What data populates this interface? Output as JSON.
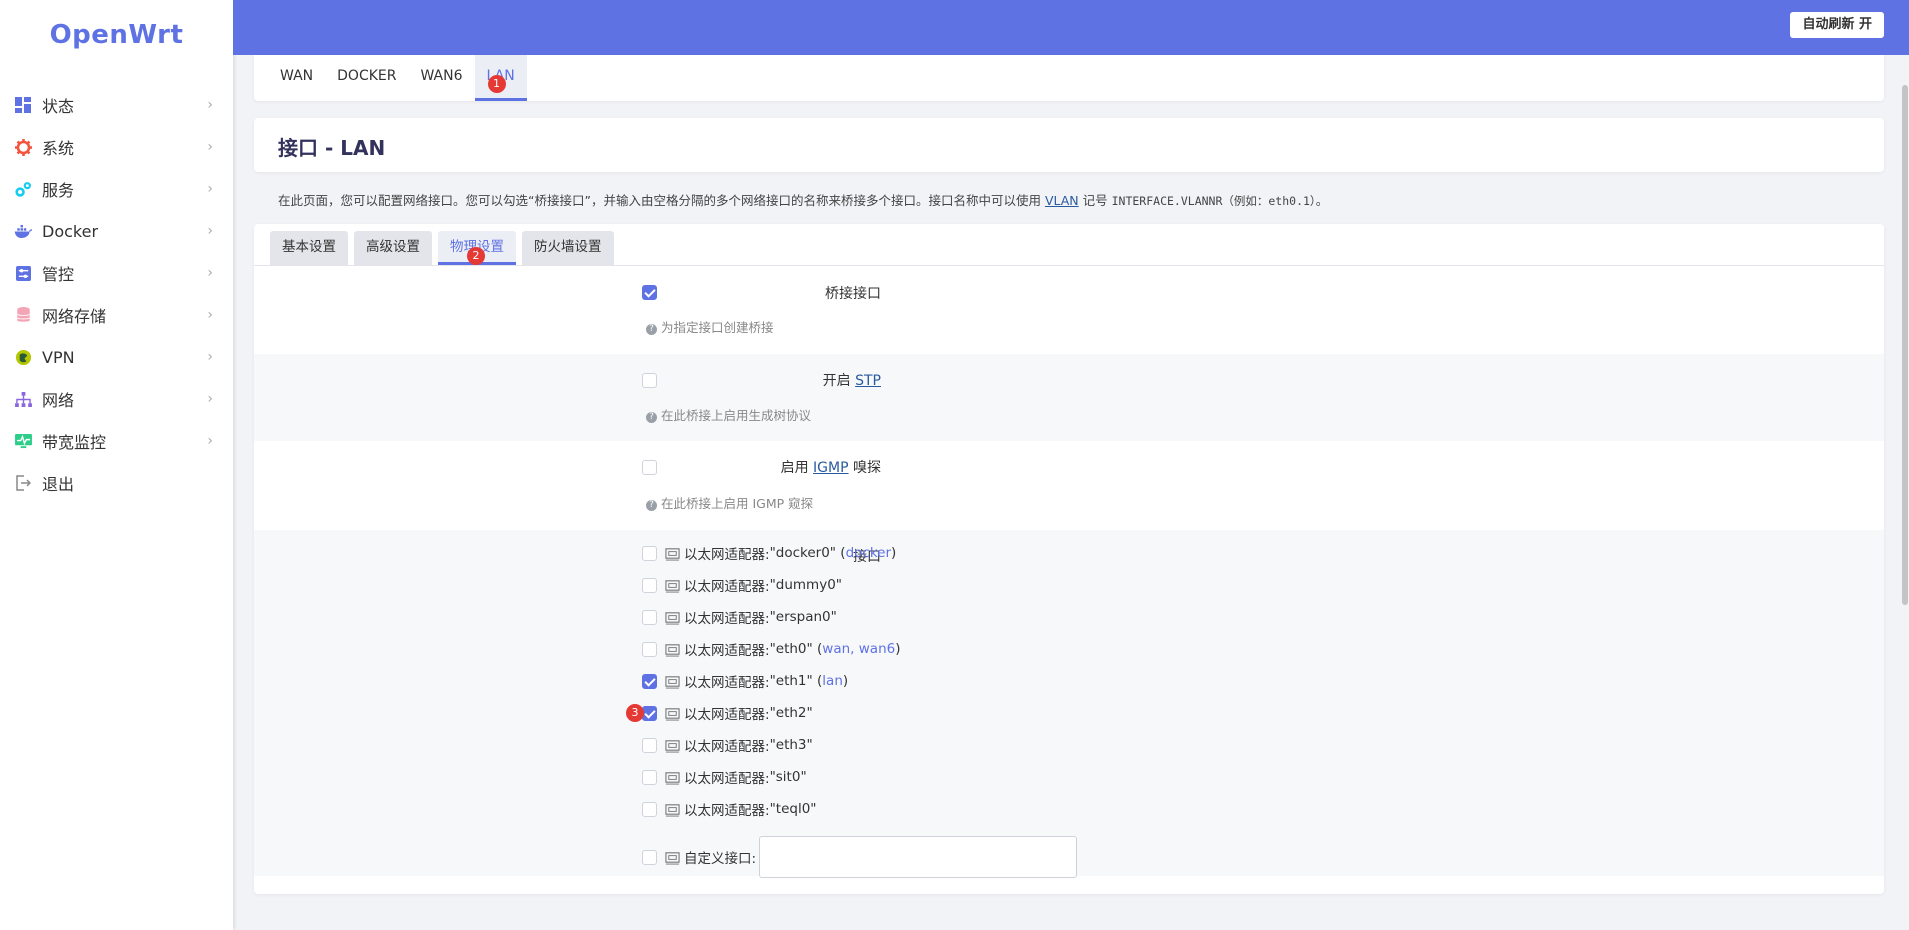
{
  "brand": "OpenWrt",
  "sidebar": {
    "items": [
      {
        "label": "状态",
        "icon": "dashboard-icon",
        "color": "#5e72e4"
      },
      {
        "label": "系统",
        "icon": "gear-icon",
        "color": "#f5533d"
      },
      {
        "label": "服务",
        "icon": "cogs-icon",
        "color": "#11cdef"
      },
      {
        "label": "Docker",
        "icon": "docker-icon",
        "color": "#5e72e4"
      },
      {
        "label": "管控",
        "icon": "sliders-icon",
        "color": "#5e72e4"
      },
      {
        "label": "网络存储",
        "icon": "database-icon",
        "color": "#f3a4b5"
      },
      {
        "label": "VPN",
        "icon": "vpn-icon",
        "color": "#b5c700"
      },
      {
        "label": "网络",
        "icon": "sitemap-icon",
        "color": "#8965e0"
      },
      {
        "label": "带宽监控",
        "icon": "monitor-icon",
        "color": "#2dce89"
      },
      {
        "label": "退出",
        "icon": "logout-icon",
        "color": "#888888"
      }
    ],
    "chevron": "›"
  },
  "header": {
    "refresh_label": "自动刷新 开",
    "bg_color": "#5e72e4"
  },
  "iface_tabs": [
    {
      "label": "WAN",
      "active": false
    },
    {
      "label": "DOCKER",
      "active": false
    },
    {
      "label": "WAN6",
      "active": false
    },
    {
      "label": "LAN",
      "active": true
    }
  ],
  "page_title": "接口 - LAN",
  "description": {
    "part1": "在此页面，您可以配置网络接口。您可以勾选“桥接接口”，并输入由空格分隔的多个网络接口的名称来桥接多个接口。接口名称中可以使用 ",
    "link": "VLAN",
    "part2": " 记号 ",
    "code": "INTERFACE.VLANNR（例如：eth0.1）",
    "part3": "。"
  },
  "sub_tabs": [
    {
      "label": "基本设置",
      "active": false
    },
    {
      "label": "高级设置",
      "active": false
    },
    {
      "label": "物理设置",
      "active": true
    },
    {
      "label": "防火墙设置",
      "active": false
    }
  ],
  "form": {
    "bridge": {
      "label": "桥接接口",
      "checked": true,
      "hint": "为指定接口创建桥接"
    },
    "stp": {
      "label_prefix": "开启 ",
      "label_link": "STP",
      "checked": false,
      "hint": "在此桥接上启用生成树协议"
    },
    "igmp": {
      "label_prefix": "启用 ",
      "label_link": "IGMP",
      "label_suffix": " 嗅探",
      "checked": false,
      "hint": "在此桥接上启用 IGMP 窥探"
    },
    "iface_label": "接口",
    "adapter_prefix": "以太网适配器: ",
    "interfaces": [
      {
        "name": "\"docker0\"",
        "networks": "docker",
        "checked": false
      },
      {
        "name": "\"dummy0\"",
        "networks": "",
        "checked": false
      },
      {
        "name": "\"erspan0\"",
        "networks": "",
        "checked": false
      },
      {
        "name": "\"eth0\"",
        "networks": "wan, wan6",
        "checked": false
      },
      {
        "name": "\"eth1\"",
        "networks": "lan",
        "checked": true
      },
      {
        "name": "\"eth2\"",
        "networks": "",
        "checked": true
      },
      {
        "name": "\"eth3\"",
        "networks": "",
        "checked": false
      },
      {
        "name": "\"sit0\"",
        "networks": "",
        "checked": false
      },
      {
        "name": "\"teql0\"",
        "networks": "",
        "checked": false
      }
    ],
    "custom_label": "自定义接口:",
    "custom_value": ""
  },
  "badges": [
    "1",
    "2",
    "3"
  ],
  "hint_icon": "?"
}
